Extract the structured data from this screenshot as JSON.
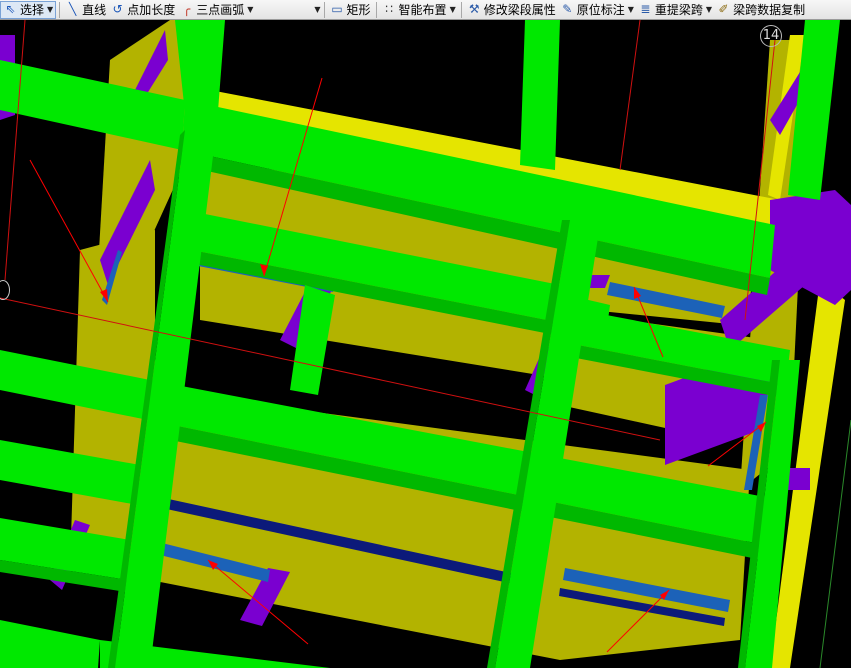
{
  "toolbar": {
    "select_label": "选择",
    "line_label": "直线",
    "point_length_label": "点加长度",
    "three_point_arc_label": "三点画弧",
    "rectangle_label": "矩形",
    "smart_layout_label": "智能布置",
    "modify_segment_label": "修改梁段属性",
    "in_situ_label": "原位标注",
    "repick_span_label": "重提梁跨",
    "span_copy_label": "梁跨数据复制"
  },
  "viewport": {
    "axis_label": "14"
  },
  "colors": {
    "beam_green": "#00e800",
    "beam_green_dark": "#00b800",
    "slab_olive": "#b3b300",
    "slab_yellow": "#e5e500",
    "column_purple": "#7a00d0",
    "rebar_blue": "#1c62b8",
    "rebar_navy": "#0c1a7a",
    "arrow_red": "#ff0000",
    "background": "#000000"
  },
  "icons": [
    "select-cursor-icon",
    "line-icon",
    "point-length-icon",
    "arc-icon",
    "rectangle-icon",
    "smart-layout-icon",
    "modify-beam-icon",
    "in-situ-annotation-icon",
    "repick-span-icon",
    "span-copy-icon"
  ]
}
